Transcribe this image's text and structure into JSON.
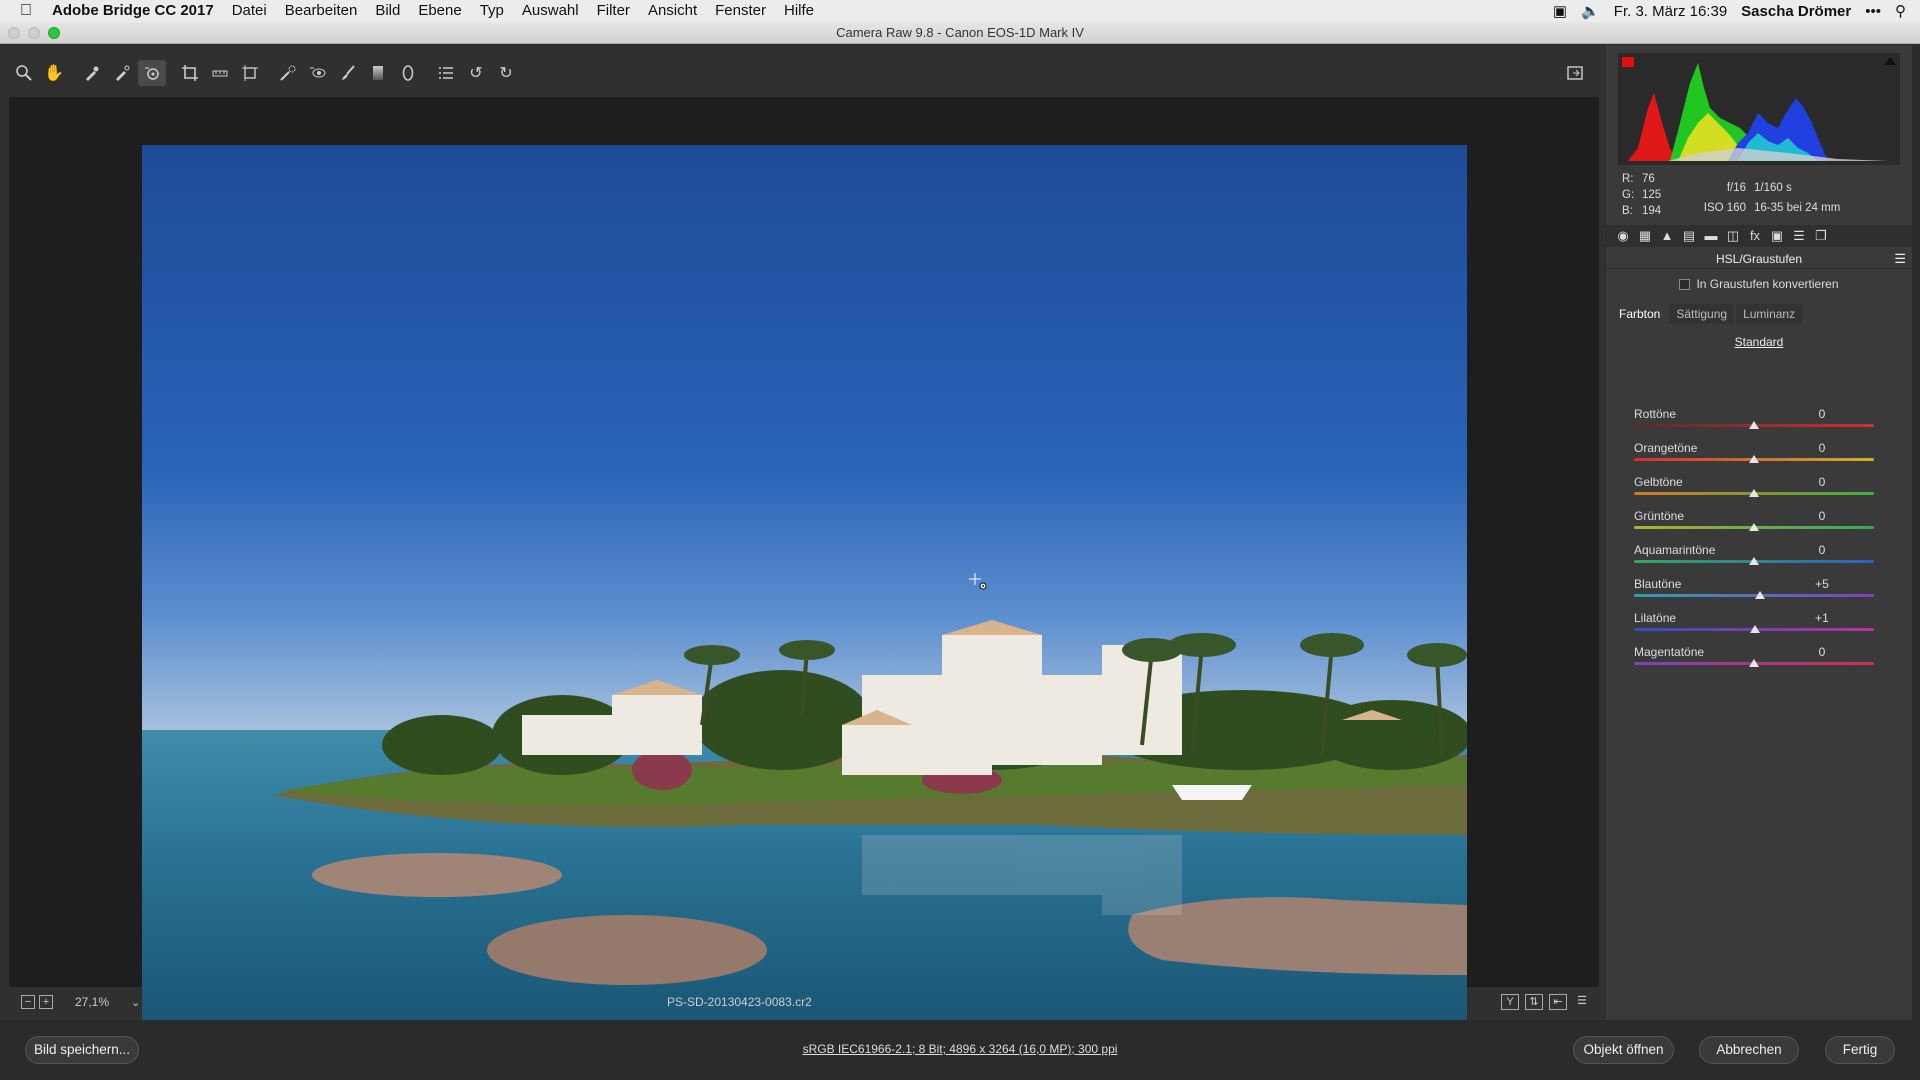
{
  "menubar": {
    "items": [
      "Adobe Bridge CC 2017",
      "Datei",
      "Bearbeiten",
      "Bild",
      "Ebene",
      "Typ",
      "Auswahl",
      "Filter",
      "Ansicht",
      "Fenster",
      "Hilfe"
    ],
    "datetime": "Fr. 3. März 16:39",
    "user": "Sascha Drömer",
    "more": "•••"
  },
  "window": {
    "title": "Camera Raw 9.8 - Canon EOS-1D Mark IV"
  },
  "status": {
    "zoom": "27,1%",
    "filename": "PS-SD-20130423-0083.cr2"
  },
  "readout": {
    "r_label": "R:",
    "r": "76",
    "g_label": "G:",
    "g": "125",
    "b_label": "B:",
    "b": "194",
    "aperture": "f/16",
    "shutter": "1/160 s",
    "iso": "ISO 160",
    "lens": "16-35 bei 24 mm"
  },
  "panel": {
    "title": "HSL/Graustufen",
    "grayscale_label": "In Graustufen konvertieren",
    "tabs": [
      "Farbton",
      "Sättigung",
      "Luminanz"
    ],
    "standard_link": "Standard",
    "sliders": [
      {
        "name": "Rottöne",
        "value": "0",
        "level": 0,
        "c1": "#5a2a2a",
        "c2": "#d03030"
      },
      {
        "name": "Orangetöne",
        "value": "0",
        "level": 0,
        "c1": "#d03030",
        "c2": "#d0b030"
      },
      {
        "name": "Gelbtöne",
        "value": "0",
        "level": 0,
        "c1": "#d07a20",
        "c2": "#40b040"
      },
      {
        "name": "Grüntöne",
        "value": "0",
        "level": 0,
        "c1": "#b0b030",
        "c2": "#30a860"
      },
      {
        "name": "Aquamarintöne",
        "value": "0",
        "level": 0,
        "c1": "#30a860",
        "c2": "#3060c0"
      },
      {
        "name": "Blautöne",
        "value": "+5",
        "level": 5,
        "c1": "#30a0b0",
        "c2": "#8040c0"
      },
      {
        "name": "Lilatöne",
        "value": "+1",
        "level": 1,
        "c1": "#3050c0",
        "c2": "#c030a0"
      },
      {
        "name": "Magentatöne",
        "value": "0",
        "level": 0,
        "c1": "#8040c0",
        "c2": "#d03050"
      }
    ]
  },
  "bottom": {
    "save_label": "Bild speichern...",
    "workflow": "sRGB IEC61966-2.1; 8 Bit; 4896 x 3264 (16,0 MP); 300 ppi",
    "open_label": "Objekt öffnen",
    "cancel_label": "Abbrechen",
    "done_label": "Fertig"
  },
  "tools": [
    "zoom-icon",
    "hand-icon",
    "white-balance-icon",
    "color-sampler-icon",
    "target-adjust-icon",
    "crop-icon",
    "straighten-icon",
    "transform-icon",
    "spot-removal-icon",
    "red-eye-icon",
    "adjustment-brush-icon",
    "graduated-filter-icon",
    "radial-filter-icon",
    "preferences-icon",
    "rotate-left-icon",
    "rotate-right-icon"
  ]
}
